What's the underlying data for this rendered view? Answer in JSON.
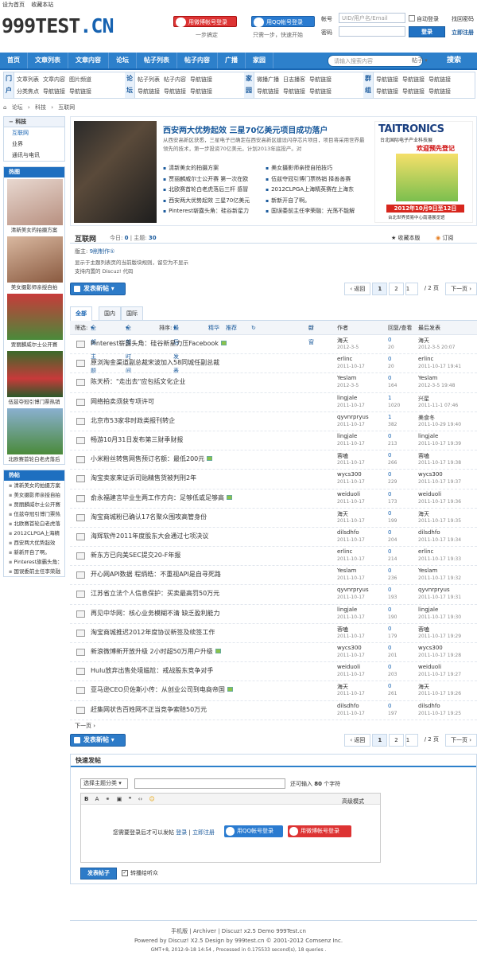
{
  "toplinks": [
    "设为首页",
    "收藏本站"
  ],
  "logo": {
    "main": "999TEST",
    "cn": ".CN"
  },
  "sso": {
    "weibo_label": "用微博帐号登录",
    "weibo_sub": "一步搞定",
    "qq_label": "用QQ帐号登录",
    "qq_sub": "只需一步，快速开始"
  },
  "login": {
    "account_label": "帐号",
    "account_placeholder": "UID/用户名/Email",
    "remember_label": "自动登录",
    "forgot": "找回密码",
    "password_label": "密码",
    "login_btn": "登录",
    "register": "立即注册"
  },
  "nav": {
    "items": [
      "首页",
      "文章列表",
      "文章内容",
      "论坛",
      "帖子列表",
      "帖子内容",
      "广播",
      "家园"
    ],
    "search_placeholder": "请输入搜索内容",
    "search_type": "帖子",
    "search_btn": "搜索"
  },
  "subnav": [
    {
      "tag": "门户",
      "links": [
        "文章列表",
        "文章内容",
        "图片频道",
        "分类焦点",
        "导航链接",
        "导航链接"
      ]
    },
    {
      "tag": "论坛",
      "links": [
        "帖子列表",
        "帖子内容",
        "导航链接",
        "导航链接",
        "导航链接",
        "导航链接"
      ]
    },
    {
      "tag": "家园",
      "links": [
        "微播广播",
        "日志播客",
        "导航链接",
        "导航链接",
        "导航链接",
        "导航链接"
      ]
    },
    {
      "tag": "群组",
      "links": [
        "导航链接",
        "导航链接",
        "导航链接",
        "导航链接",
        "导航链接",
        "导航链接"
      ]
    }
  ],
  "breadcrumb": [
    "论坛",
    "›",
    "科技",
    "›",
    "互联网"
  ],
  "sidebar": {
    "cat_title": "科技",
    "cat_items": [
      "互联网",
      "业界",
      "通讯与电讯"
    ],
    "hot_title": "热图",
    "pics": [
      {
        "caption": "清新美女的拍摄方案"
      },
      {
        "caption": "美女摄影师亲授自拍"
      },
      {
        "caption": "贾丽麟威尔士公开赛"
      },
      {
        "caption": "伍兹夺冠引博门票热销"
      },
      {
        "caption": "北欧赛首轮白老虎落后"
      }
    ],
    "hotpost_title": "热帖",
    "hotposts": [
      "清新美女的拍摄方案",
      "美女摄影师亲授自拍",
      "贾丽麟威尔士公开赛",
      "伍兹夺冠引博门票热",
      "北欧赛首轮白老虎落",
      "2012CLPGA上海精",
      "西安两大优势起效",
      "新新开自了啊。",
      "Pinterest旗霸头角：",
      "国误委前主任李荣融"
    ]
  },
  "feature": {
    "title": "西安两大优势起效 三星70亿美元项目成功落户",
    "desc": "从西安高新区获悉，三星电子已确定在西安高新区建设闪存芯片项目，项目将采用世界最领先的技术，第一步投资70亿美元，计划2013年底投产。对",
    "list": [
      "清新美女的拍摄方案",
      "美女摄影师亲授自拍技巧",
      "贾丽麟威尔士公开赛 第一次在欧",
      "伍兹夺冠引博门票热销 择善善赛",
      "北欧赛首轮白老虎落后三杆 感冒",
      "2012CLPGA上海精英赛在上海东",
      "西安两大优势起效 三星70亿美元",
      "新新开自了啊。",
      "Pinterest崭露头角：硅谷新星力",
      "国误委前主任李荣融：光荡不能解"
    ]
  },
  "ad": {
    "logo": "TAITRONICS",
    "sub": "台北国际电子产业科技展",
    "welcome": "欢迎预先登记",
    "date": "2012年10月9日至12日",
    "place": "台北世界贸易中心南港展览馆"
  },
  "forum": {
    "name": "互联网",
    "today_label": "今日:",
    "today": "0",
    "topics_label": "主题:",
    "topics": "30",
    "fav": "收藏本版",
    "rss": "订阅",
    "mod_label": "版主:",
    "mod": "9削制作①",
    "rules1": "显示于主题列表页的当前版块规则，留空为不显示",
    "rules2": "支持内置的 Discuz! 代码"
  },
  "newpost_label": "发表新帖",
  "pager": {
    "prev": "‹ 返回",
    "p1": "1",
    "p2": "2",
    "input": "1",
    "total": "/ 2 页",
    "next": "下一页 ›"
  },
  "tabs": [
    "全部",
    "国内",
    "国际"
  ],
  "filter": {
    "sel_label": "筛选:",
    "all_topics": "全部主题",
    "all_time": "全部时间",
    "sort_label": "排序:",
    "sort_value": "最后发表",
    "digest": "精华",
    "recommend": "推荐",
    "new_window": "新窗",
    "col_author": "作者",
    "col_reply": "回复/查看",
    "col_last": "最后发表"
  },
  "threads": [
    {
      "title": "Pinterest崭露头角：硅谷新星力压Facebook",
      "author": "海天",
      "adate": "2012-3-5",
      "rep": "0",
      "view": "20",
      "last": "海天",
      "ldate": "2012-3-5 20:07",
      "img": true
    },
    {
      "title": "原浏淘金渠道副总裁宋波加入58同城任副总裁",
      "author": "erlinc",
      "adate": "2011-10-17",
      "rep": "0",
      "view": "20",
      "last": "erlinc",
      "ldate": "2011-10-17 19:41",
      "img": false
    },
    {
      "title": "陈天桥：\"走出去\"应包括文化企业",
      "author": "Yeslam",
      "adate": "2012-3-5",
      "rep": "0",
      "view": "164",
      "last": "Yeslam",
      "ldate": "2012-3-5 19:48",
      "img": false
    },
    {
      "title": "网络拍卖须获专项许可",
      "author": "lingjale",
      "adate": "2011-10-17",
      "rep": "1",
      "view": "1020",
      "last": "兴星",
      "ldate": "2011-11-1 07:46",
      "img": false
    },
    {
      "title": "北京市53家非时政类报刊转企",
      "author": "qyvnrpryus",
      "adate": "2011-10-17",
      "rep": "1",
      "view": "382",
      "last": "美食冬",
      "ldate": "2011-10-29 19:40",
      "img": false
    },
    {
      "title": "畅游10月31日发布第三财季财报",
      "author": "lingjale",
      "adate": "2011-10-17",
      "rep": "0",
      "view": "213",
      "last": "lingjale",
      "ldate": "2011-10-17 19:39",
      "img": false
    },
    {
      "title": "小米粉丝转售网售预订名额：最低200元",
      "author": "蓉嗑",
      "adate": "2011-10-17",
      "rep": "0",
      "view": "266",
      "last": "蓉嗑",
      "ldate": "2011-10-17 19:38",
      "img": true
    },
    {
      "title": "淘宝卖家来证诉司贴精售货被判刑2年",
      "author": "wycs300",
      "adate": "2011-10-17",
      "rep": "0",
      "view": "229",
      "last": "wycs300",
      "ldate": "2011-10-17 19:37",
      "img": false
    },
    {
      "title": "俞永福建言毕业生两工作方向：足够低或足够高",
      "author": "weiduoli",
      "adate": "2011-10-17",
      "rep": "0",
      "view": "173",
      "last": "weiduoli",
      "ldate": "2011-10-17 19:36",
      "img": true
    },
    {
      "title": "淘宝商城粉已确认17名聚众围攻高管身份",
      "author": "海天",
      "adate": "2011-10-17",
      "rep": "0",
      "view": "199",
      "last": "海天",
      "ldate": "2011-10-17 19:35",
      "img": false
    },
    {
      "title": "海辉软件2011年度股东大会通过七项决议",
      "author": "dilsdhfo",
      "adate": "2011-10-17",
      "rep": "0",
      "view": "204",
      "last": "dilsdhfo",
      "ldate": "2011-10-17 19:34",
      "img": false
    },
    {
      "title": "新东方已向美SEC提交20-F年报",
      "author": "erlinc",
      "adate": "2011-10-17",
      "rep": "0",
      "view": "214",
      "last": "erlinc",
      "ldate": "2011-10-17 19:33",
      "img": false
    },
    {
      "title": "开心网API数据 程炳皓：不重视API是自寻死路",
      "author": "Yeslam",
      "adate": "2011-10-17",
      "rep": "0",
      "view": "236",
      "last": "Yeslam",
      "ldate": "2011-10-17 19:32",
      "img": false
    },
    {
      "title": "江苏省立法个人信息保护：买卖最高罚50万元",
      "author": "qyvnrpryus",
      "adate": "2011-10-17",
      "rep": "0",
      "view": "193",
      "last": "qyvnrpryus",
      "ldate": "2011-10-17 19:31",
      "img": false
    },
    {
      "title": "再见中华网：核心业务模糊不清 缺乏盈利能力",
      "author": "lingjale",
      "adate": "2011-10-17",
      "rep": "0",
      "view": "190",
      "last": "lingjale",
      "ldate": "2011-10-17 19:30",
      "img": false
    },
    {
      "title": "淘宝商城推迟2012年度协议新签及续签工作",
      "author": "蓉嗑",
      "adate": "2011-10-17",
      "rep": "0",
      "view": "179",
      "last": "蓉嗑",
      "ldate": "2011-10-17 19:29",
      "img": false
    },
    {
      "title": "新浪微博新开放升级 2小时超50万用户升级",
      "author": "wycs300",
      "adate": "2011-10-17",
      "rep": "0",
      "view": "201",
      "last": "wycs300",
      "ldate": "2011-10-17 19:28",
      "img": true
    },
    {
      "title": "Hulu放弃出售处境尴尬：戒战股东竞争对手",
      "author": "weiduoli",
      "adate": "2011-10-17",
      "rep": "0",
      "view": "203",
      "last": "weiduoli",
      "ldate": "2011-10-17 19:27",
      "img": false
    },
    {
      "title": "亚马逊CEO贝佐斯小传：从创业公司到电商帝国",
      "author": "海天",
      "adate": "2011-10-17",
      "rep": "0",
      "view": "261",
      "last": "海天",
      "ldate": "2011-10-17 19:26",
      "img": true
    },
    {
      "title": "赶集网状告百姓网不正当竞争索赔50万元",
      "author": "dilsdhfo",
      "adate": "2011-10-17",
      "rep": "0",
      "view": "197",
      "last": "dilsdhfo",
      "ldate": "2011-10-17 19:25",
      "img": false
    }
  ],
  "next_page": "下一页 ›",
  "quick": {
    "title": "快速发帖",
    "type_sel": "选择主题分类",
    "hint_pre": "还可输入",
    "hint_num": "80",
    "hint_post": "个字符",
    "adv": "高级模式",
    "msg_pre": "您需要登录后才可以发帖",
    "msg_login": "登录",
    "msg_sep": "|",
    "msg_reg": "立即注册",
    "qq": "用QQ帐号登录",
    "weibo": "用微博帐号登录",
    "submit": "发表帖子",
    "sync": "转播给听众"
  },
  "footer": {
    "line1": "手机版 | Archiver | Discuz! x2.5 Demo 999Test.cn",
    "line2": "Powered by Discuz! X2.5 Design by 999test.cn © 2001-2012 Comsenz Inc.",
    "line3": "GMT+8, 2012-9-18 14:54 , Processed in 0.175533 second(s), 18 queries ."
  }
}
